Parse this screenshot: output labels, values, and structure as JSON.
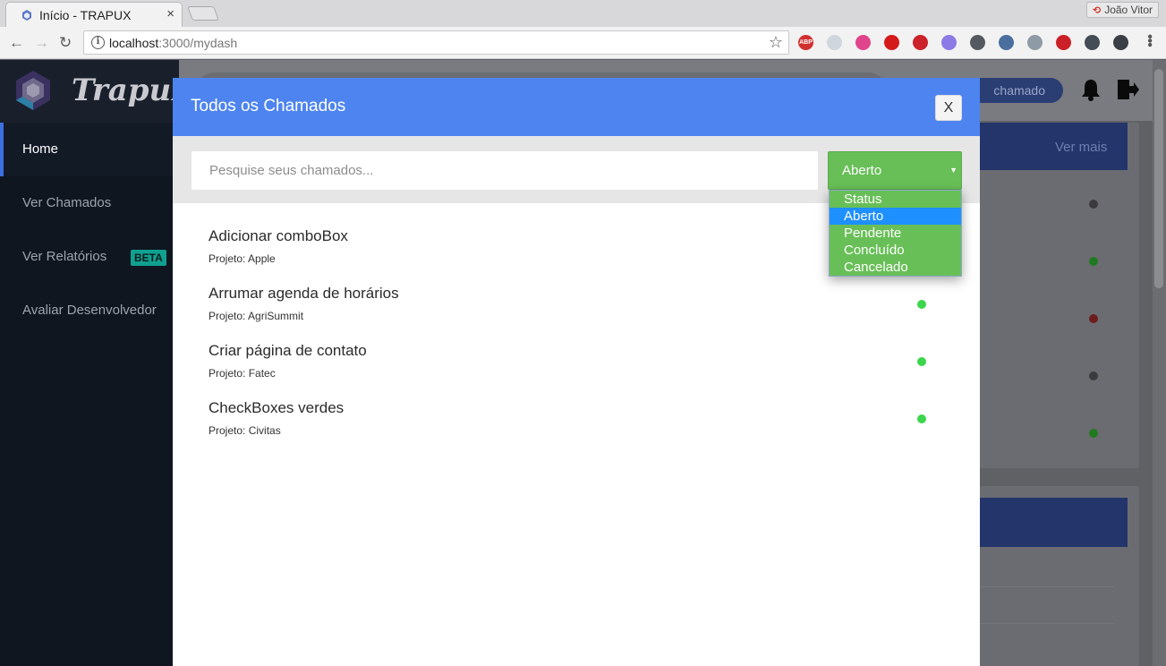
{
  "browser": {
    "tab_title": "Início - TRAPUX",
    "tab_close": "×",
    "profile_name": "João Vitor",
    "url_host": "localhost",
    "url_path": ":3000/mydash",
    "extensions": [
      {
        "name": "adblock-icon",
        "color": "#d22f2f",
        "label": "ABP"
      },
      {
        "name": "pen-icon",
        "color": "#cfd6de",
        "label": ""
      },
      {
        "name": "color-wheel-icon",
        "color": "#e0458b",
        "label": ""
      },
      {
        "name": "opera-icon",
        "color": "#d51a1a",
        "label": ""
      },
      {
        "name": "lastpass-icon",
        "color": "#cc2229",
        "label": ""
      },
      {
        "name": "clipboard-icon",
        "color": "#8c7ae6",
        "label": ""
      },
      {
        "name": "pocket-icon",
        "color": "#555a60",
        "label": ""
      },
      {
        "name": "eyedropper-icon",
        "color": "#4a6f9e",
        "label": ""
      },
      {
        "name": "download-icon",
        "color": "#8e9aa6",
        "label": ""
      },
      {
        "name": "pinterest-icon",
        "color": "#cb2027",
        "label": ""
      },
      {
        "name": "bug-icon",
        "color": "#444c55",
        "label": ""
      },
      {
        "name": "shield-icon",
        "color": "#3a3f45",
        "label": ""
      }
    ]
  },
  "app": {
    "logo_text": "Trapux",
    "sidebar": {
      "items": [
        {
          "label": "Home"
        },
        {
          "label": "Ver Chamados"
        },
        {
          "label": "Ver Relatórios",
          "badge": "BETA"
        },
        {
          "label": "Avaliar Desenvolvedor"
        }
      ]
    },
    "header": {
      "new_ticket_pill": "chamado"
    },
    "background": {
      "ver_mais": "Ver mais",
      "status_colors": [
        "#3b3b3e",
        "#1f7a1f",
        "#6e1d1d",
        "#3b3b3e",
        "#1f7a1f"
      ]
    }
  },
  "modal": {
    "title": "Todos os Chamados",
    "close_label": "X",
    "search_placeholder": "Pesquise seus chamados...",
    "status_select": {
      "selected": "Aberto",
      "caret": "▼",
      "options": [
        "Status",
        "Aberto",
        "Pendente",
        "Concluído",
        "Cancelado"
      ],
      "selected_index": 1
    },
    "tickets": [
      {
        "title": "Adicionar comboBox",
        "project": "Projeto: Apple",
        "status_color": "#3bd64b"
      },
      {
        "title": "Arrumar agenda de horários",
        "project": "Projeto: AgriSummit",
        "status_color": "#3bd64b"
      },
      {
        "title": "Criar página de contato",
        "project": "Projeto: Fatec",
        "status_color": "#3bd64b"
      },
      {
        "title": "CheckBoxes verdes",
        "project": "Projeto: Civitas",
        "status_color": "#3bd64b"
      }
    ]
  }
}
